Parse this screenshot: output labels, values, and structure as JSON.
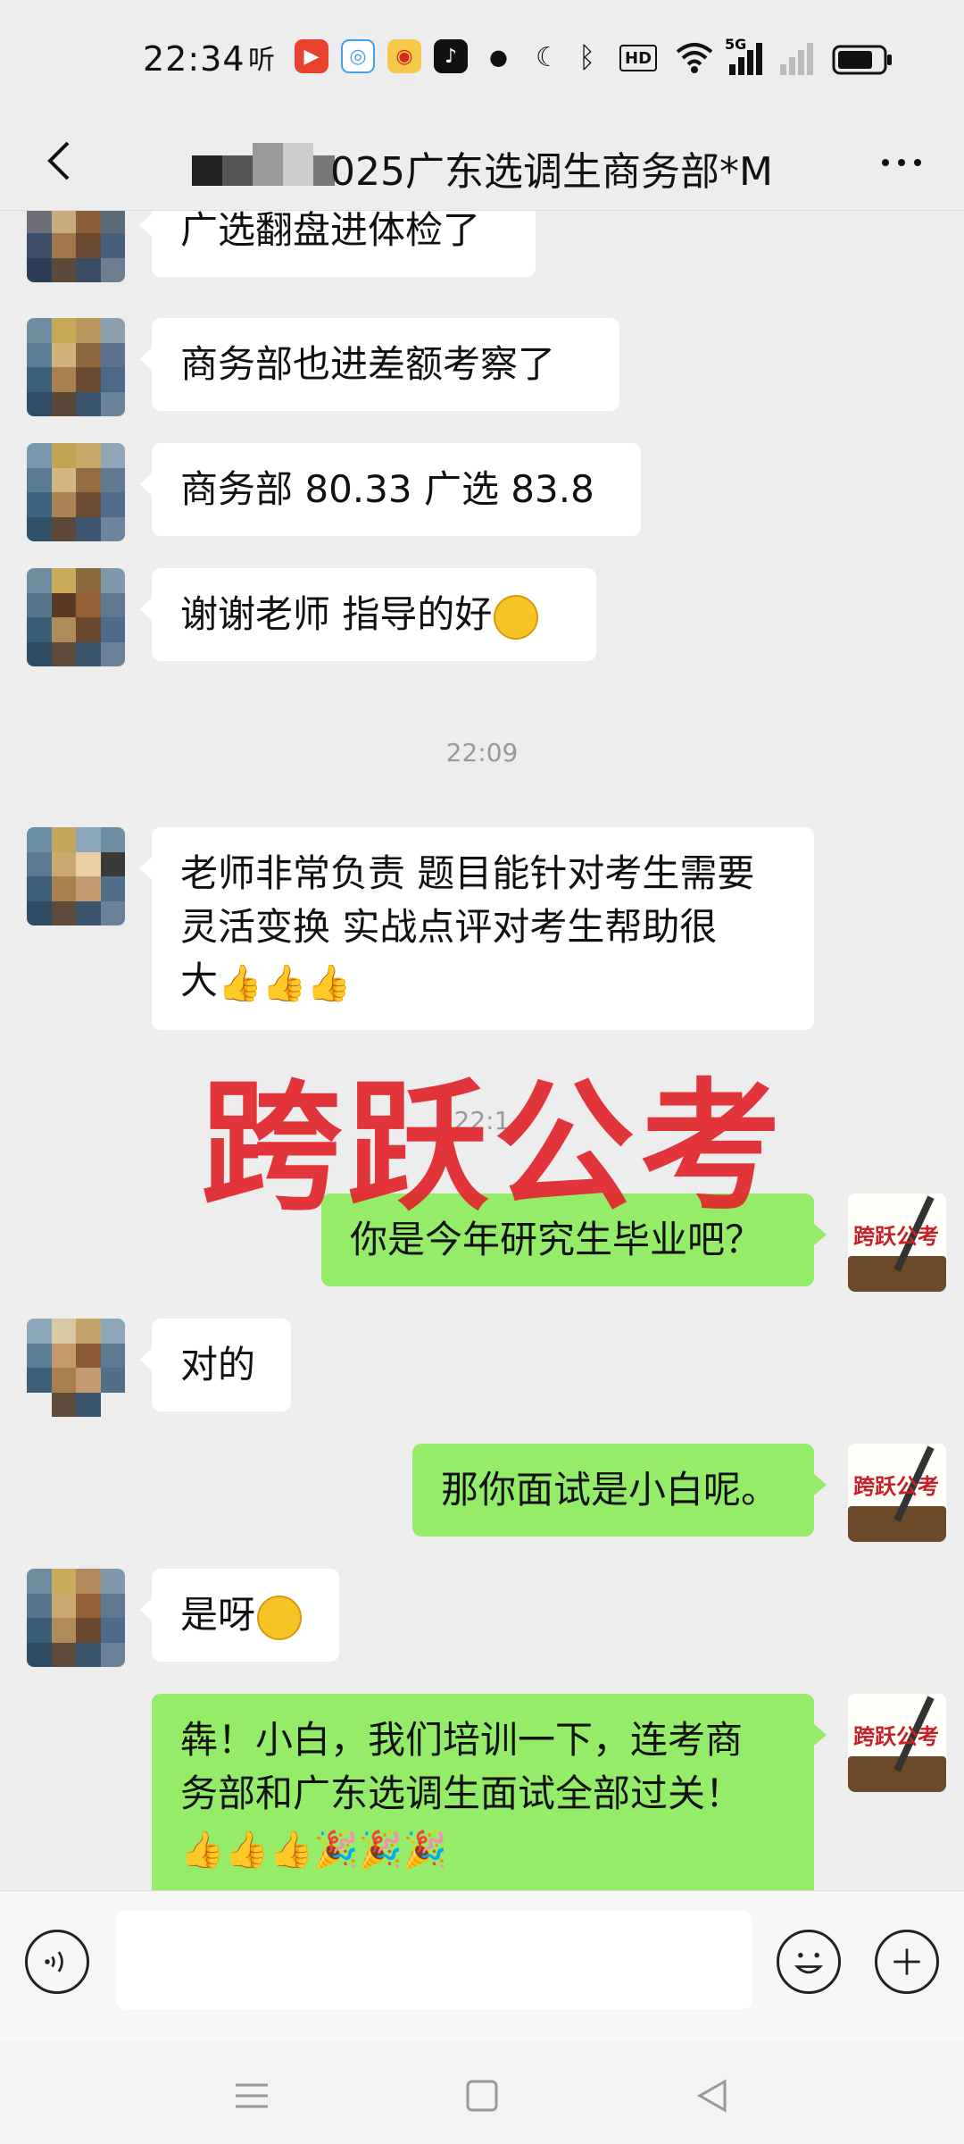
{
  "status_bar": {
    "time": "22:34",
    "icons": [
      "ting-app-icon",
      "video-app-icon",
      "browser-app-icon",
      "weibo-icon",
      "tiktok-icon",
      "dot-icon",
      "moon-icon",
      "bluetooth-icon",
      "hd-icon",
      "wifi-icon",
      "5g-signal-icon",
      "sim2-signal-icon",
      "battery-icon"
    ],
    "ting_label": "听",
    "hd_label": "HD",
    "net_label": "5G"
  },
  "header": {
    "title": "025广东选调生商务部*M",
    "back_icon": "chevron-left-icon",
    "more_icon": "more-dots-icon"
  },
  "messages": [
    {
      "side": "in",
      "text": "广选翻盘进体检了"
    },
    {
      "side": "in",
      "text": "商务部也进差额考察了"
    },
    {
      "side": "in",
      "text": "商务部 80.33   广选 83.8"
    },
    {
      "side": "in",
      "text": "谢谢老师 指导的好",
      "emoji": "grin-emoji"
    },
    {
      "type": "time",
      "text": "22:09"
    },
    {
      "side": "in",
      "lines": [
        "老师非常负责 题目能针对考生需要",
        "灵活变换  实战点评对考生帮助很",
        "大"
      ],
      "emoji": "thumbs-up x3"
    },
    {
      "type": "time",
      "text": "22:1"
    },
    {
      "side": "out",
      "text": "你是今年研究生毕业吧？"
    },
    {
      "side": "in",
      "text": "对的"
    },
    {
      "side": "out",
      "text": "那你面试是小白呢。"
    },
    {
      "side": "in",
      "text": "是呀",
      "emoji": "grin-emoji"
    },
    {
      "side": "out",
      "lines": [
        "犇！小白，我们培训一下，连考商",
        "务部和广东选调生面试全部过关！"
      ],
      "emoji": "thumbs-up x3, party-popper x3"
    }
  ],
  "watermark": "跨跃公考",
  "my_avatar_text": "跨跃公考",
  "input_bar": {
    "placeholder": "",
    "voice_icon": "voice-icon",
    "emoji_icon": "smiley-icon",
    "plus_icon": "plus-icon"
  },
  "nav_bar": [
    "menu-icon",
    "home-square-icon",
    "back-triangle-icon"
  ],
  "colors": {
    "background": "#ededed",
    "bubble_in": "#ffffff",
    "bubble_out": "#95ec69",
    "watermark": "#e0262c"
  }
}
